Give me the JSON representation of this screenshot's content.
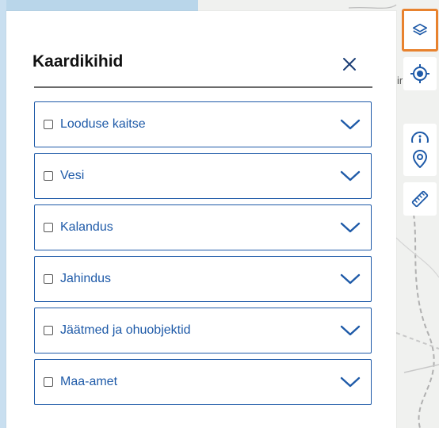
{
  "panel": {
    "title": "Kaardikihid",
    "layers": [
      {
        "label": "Looduse kaitse",
        "checked": false
      },
      {
        "label": "Vesi",
        "checked": false
      },
      {
        "label": "Kalandus",
        "checked": false
      },
      {
        "label": "Jahindus",
        "checked": false
      },
      {
        "label": "Jäätmed ja ohuobjektid",
        "checked": false
      },
      {
        "label": "Maa-amet",
        "checked": false
      }
    ]
  },
  "toolbar": {
    "buttons": [
      {
        "icon": "layers-icon",
        "active": true
      },
      {
        "icon": "locate-icon",
        "active": false
      },
      {
        "icon": "info-icon",
        "active": false
      },
      {
        "icon": "location-pin-icon",
        "active": false
      },
      {
        "icon": "ruler-icon",
        "active": false
      }
    ]
  },
  "map": {
    "edge_text": "ir"
  },
  "colors": {
    "accent": "#1e5aa8",
    "active_border": "#e8822e",
    "divider": "#6b6b6b",
    "map_background": "#f0f1ef"
  }
}
